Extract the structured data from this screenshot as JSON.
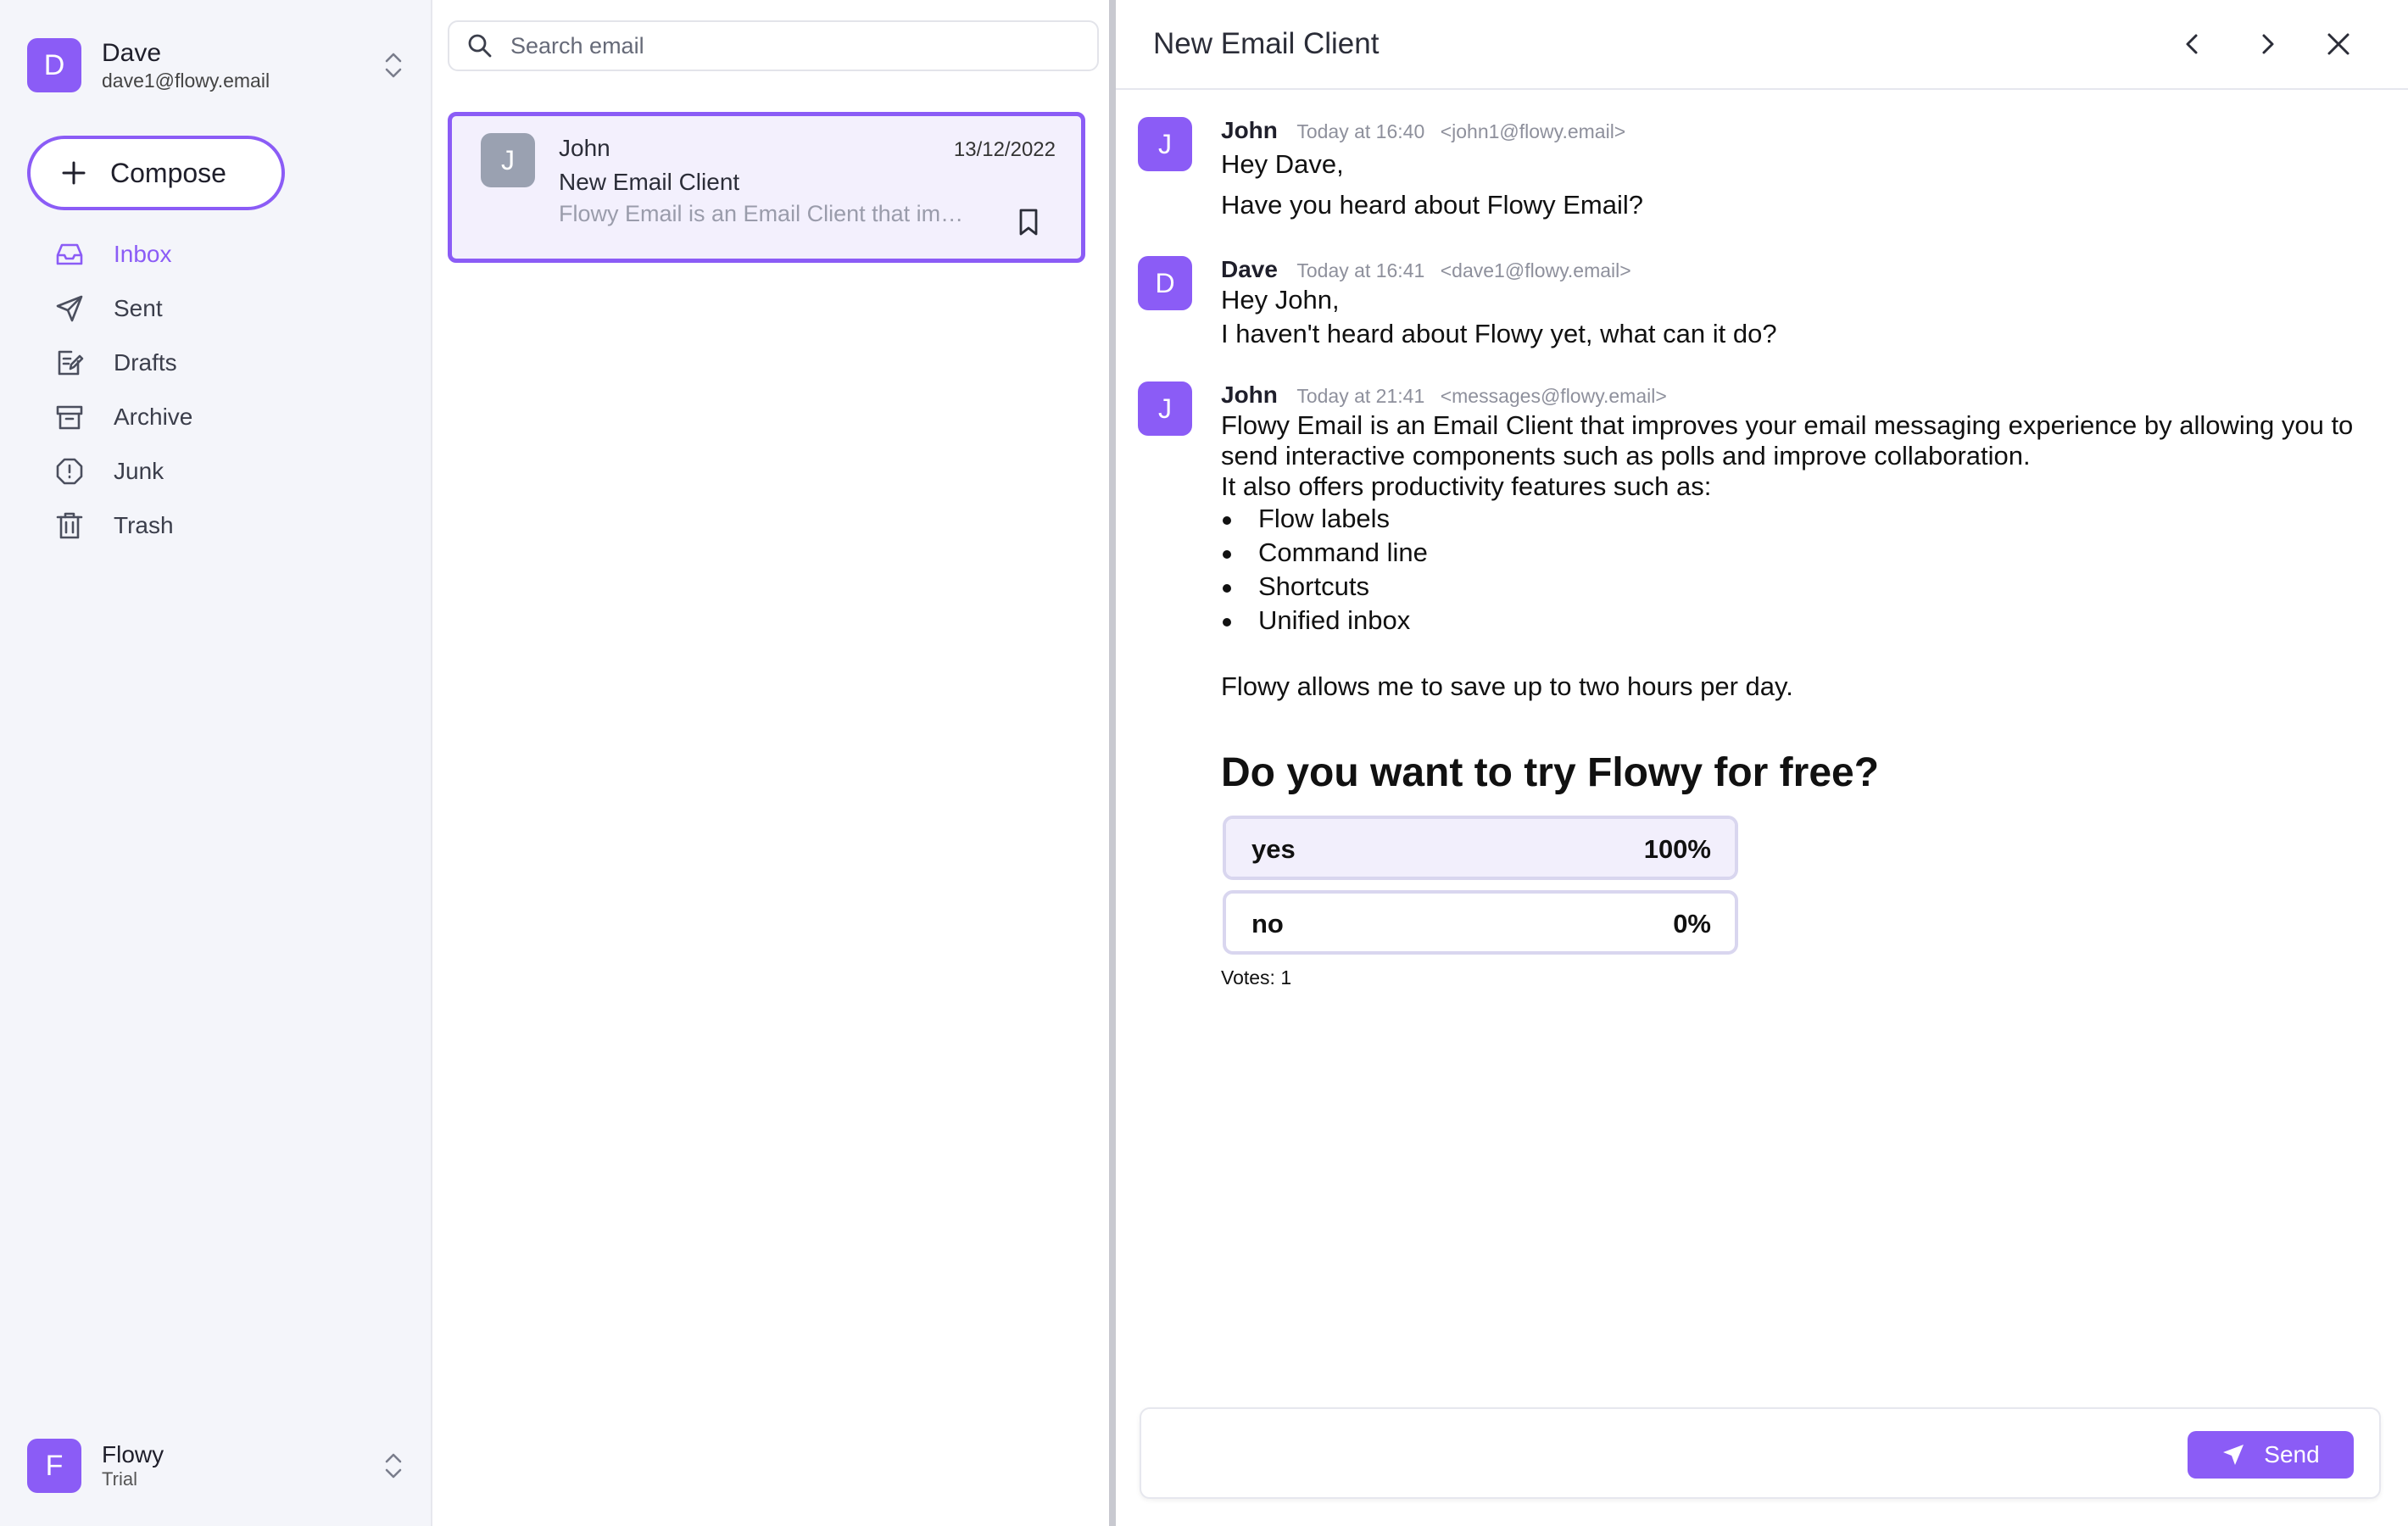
{
  "account": {
    "initial": "D",
    "name": "Dave",
    "email": "dave1@flowy.email",
    "avatar_color": "#8b5cf6"
  },
  "compose": {
    "label": "Compose",
    "icon": "plus-icon"
  },
  "nav": {
    "items": [
      {
        "label": "Inbox",
        "icon": "inbox-icon",
        "active": true
      },
      {
        "label": "Sent",
        "icon": "send-icon"
      },
      {
        "label": "Drafts",
        "icon": "drafts-icon"
      },
      {
        "label": "Archive",
        "icon": "archive-icon"
      },
      {
        "label": "Junk",
        "icon": "junk-icon"
      },
      {
        "label": "Trash",
        "icon": "trash-icon"
      }
    ]
  },
  "workspace": {
    "initial": "F",
    "name": "Flowy",
    "plan": "Trial"
  },
  "search": {
    "placeholder": "Search email",
    "value": ""
  },
  "emails": [
    {
      "initial": "J",
      "from": "John",
      "date": "13/12/2022",
      "subject": "New Email Client",
      "preview": "Flowy Email is an Email Client that imp...",
      "selected": true
    }
  ],
  "thread": {
    "title": "New Email Client",
    "messages": [
      {
        "initial": "J",
        "name": "John",
        "time": "Today at 16:40",
        "address": "<john1@flowy.email>",
        "lines": [
          "Hey Dave,",
          "Have you heard about Flowy Email?"
        ]
      },
      {
        "initial": "D",
        "name": "Dave",
        "time": "Today at 16:41",
        "address": "<dave1@flowy.email>",
        "lines": [
          "Hey John,",
          "I haven't heard about Flowy yet, what can it do?"
        ]
      },
      {
        "initial": "J",
        "name": "John",
        "time": "Today at 21:41",
        "address": "<messages@flowy.email>",
        "intro": "Flowy Email is an Email Client that improves your email messaging experience by allowing you to send interactive components such as polls and improve collaboration.",
        "intro2": "It also offers productivity features such as:",
        "bullets": [
          "Flow labels",
          "Command line",
          "Shortcuts",
          "Unified inbox"
        ],
        "outro": "Flowy allows me to save up to two hours per day."
      }
    ],
    "poll": {
      "question": "Do you want to try Flowy for free?",
      "options": [
        {
          "label": "yes",
          "percent_text": "100%",
          "fraction": 1.0
        },
        {
          "label": "no",
          "percent_text": "0%",
          "fraction": 0.0
        }
      ],
      "votes": "Votes: 1"
    }
  },
  "reply": {
    "placeholder": "",
    "send_label": "Send"
  },
  "colors": {
    "accent": "#8b5cf6",
    "avatar_gray": "#9aa1b1"
  }
}
